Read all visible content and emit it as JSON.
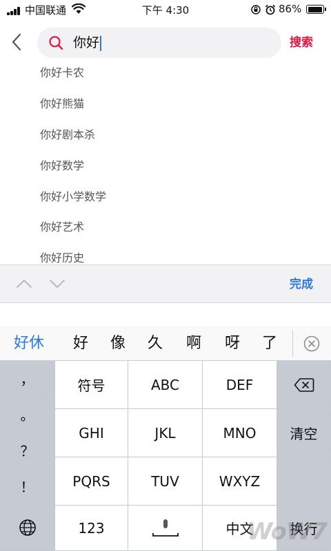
{
  "status_bar": {
    "carrier": "中国联通",
    "time": "下午 4:30",
    "battery": "86%"
  },
  "search": {
    "query": "你好",
    "button_label": "搜索"
  },
  "suggestions": [
    "你好卡农",
    "你好熊猫",
    "你好剧本杀",
    "你好数学",
    "你好小学数学",
    "你好艺术",
    "你好历史"
  ],
  "accessory": {
    "done_label": "完成"
  },
  "keyboard": {
    "candidates": [
      "好休",
      "好",
      "像",
      "久",
      "啊",
      "呀",
      "了"
    ],
    "left_column": [
      "，",
      "。",
      "？",
      "！"
    ],
    "keys": {
      "symbols": "符号",
      "abc": "ABC",
      "def": "DEF",
      "ghi": "GHI",
      "jkl": "JKL",
      "mno": "MNO",
      "pqrs": "PQRS",
      "tuv": "TUV",
      "wxyz": "WXYZ",
      "numbers": "123",
      "chinese": "中文",
      "clear": "清空",
      "enter": "换行"
    }
  },
  "watermark": "WoW7"
}
